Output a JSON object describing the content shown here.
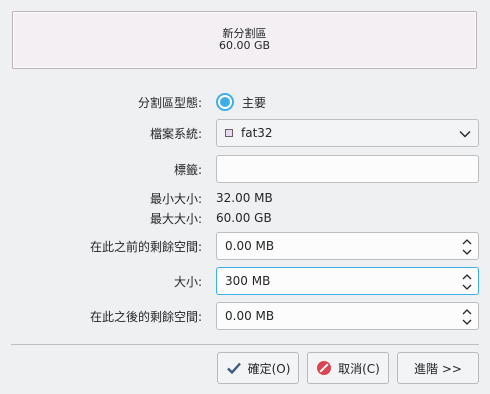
{
  "preview": {
    "name": "新分割區",
    "size": "60.00 GB"
  },
  "form": {
    "partition_type_label": "分割區型態:",
    "partition_type_value": "主要",
    "filesystem_label": "檔案系統:",
    "filesystem_value": "fat32",
    "label_label": "標籤:",
    "label_value": "",
    "min_size_label": "最小大小:",
    "min_size_value": "32.00 MB",
    "max_size_label": "最大大小:",
    "max_size_value": "60.00 GB",
    "free_before_label": "在此之前的剩餘空間:",
    "free_before_value": "0.00 MB",
    "size_label": "大小:",
    "size_value": "300 MB",
    "free_after_label": "在此之後的剩餘空間:",
    "free_after_value": "0.00 MB"
  },
  "buttons": {
    "ok": "確定(O)",
    "cancel": "取消(C)",
    "advanced": "進階 >>"
  },
  "icons": {
    "ok": "check-icon",
    "cancel": "cancel-icon"
  },
  "colors": {
    "accent": "#3daee9",
    "cancel_icon": "#da4453",
    "ok_icon": "#3d5a80"
  }
}
